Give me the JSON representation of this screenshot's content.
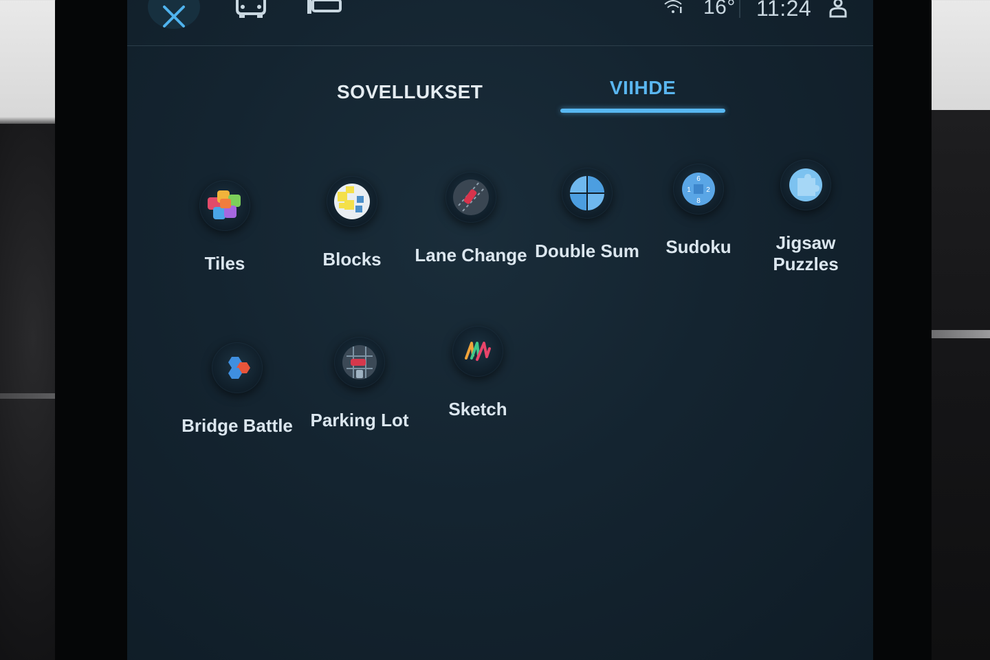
{
  "status_bar": {
    "temperature": "16°",
    "time": "11:24",
    "icons": [
      "close-icon",
      "car-icon",
      "seat-icon",
      "wifi-info-icon",
      "profile-icon"
    ]
  },
  "tabs": [
    {
      "label": "SOVELLUKSET",
      "active": false
    },
    {
      "label": "VIIHDE",
      "active": true
    }
  ],
  "apps": [
    {
      "label": "Tiles",
      "icon": "tiles-icon"
    },
    {
      "label": "Blocks",
      "icon": "blocks-icon"
    },
    {
      "label": "Lane Change",
      "icon": "lane-change-icon"
    },
    {
      "label": "Double Sum",
      "icon": "double-sum-icon"
    },
    {
      "label": "Sudoku",
      "icon": "sudoku-icon"
    },
    {
      "label": "Jigsaw\nPuzzles",
      "icon": "jigsaw-icon"
    },
    {
      "label": "Bridge Battle",
      "icon": "bridge-battle-icon"
    },
    {
      "label": "Parking Lot",
      "icon": "parking-lot-icon"
    },
    {
      "label": "Sketch",
      "icon": "sketch-icon"
    }
  ],
  "colors": {
    "accent": "#58b8f2",
    "screen_bg": "#142430",
    "text": "#dbe6ee"
  }
}
